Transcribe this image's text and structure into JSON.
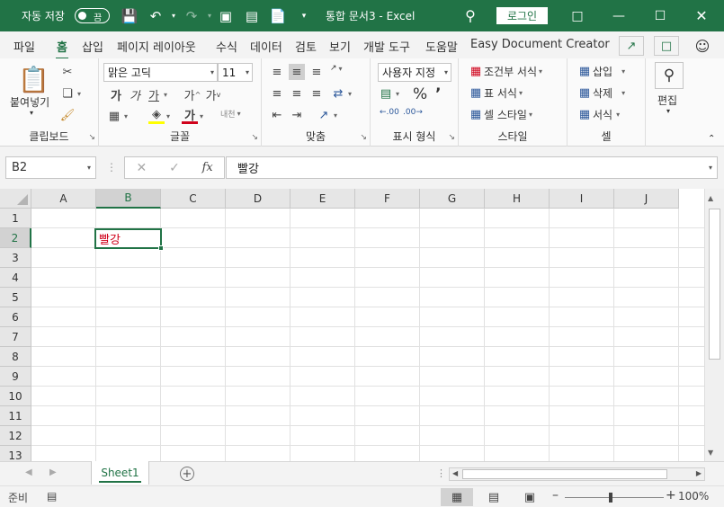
{
  "titlebar": {
    "autosave_label": "자동 저장",
    "autosave_state": "끔",
    "doc_title": "통합 문서3  -  Excel",
    "login_label": "로그인"
  },
  "tabs": [
    "파일",
    "홈",
    "삽입",
    "페이지 레이아웃",
    "수식",
    "데이터",
    "검토",
    "보기",
    "개발 도구",
    "도움말",
    "Easy Document Creator"
  ],
  "active_tab": "홈",
  "ribbon": {
    "clipboard": {
      "paste": "붙여넣기",
      "label": "클립보드"
    },
    "font": {
      "name": "맑은 고딕",
      "size": "11",
      "label": "글꼴"
    },
    "align": {
      "label": "맞춤"
    },
    "number": {
      "format": "사용자 지정",
      "label": "표시 형식"
    },
    "styles": {
      "cond": "조건부 서식",
      "table": "표 서식",
      "cell": "셀 스타일",
      "label": "스타일"
    },
    "cells": {
      "insert": "삽입",
      "delete": "삭제",
      "format": "서식",
      "label": "셀"
    },
    "edit": {
      "label": "편집"
    }
  },
  "formula": {
    "namebox": "B2",
    "content": "빨강"
  },
  "grid": {
    "columns": [
      "A",
      "B",
      "C",
      "D",
      "E",
      "F",
      "G",
      "H",
      "I",
      "J"
    ],
    "rows": [
      "1",
      "2",
      "3",
      "4",
      "5",
      "6",
      "7",
      "8",
      "9",
      "10",
      "11",
      "12",
      "13"
    ],
    "selected_column": "B",
    "selected_row": "2",
    "active_cell_value": "빨강",
    "active_cell_text_color": "#d0021b"
  },
  "sheets": [
    "Sheet1"
  ],
  "status": {
    "ready": "준비",
    "zoom": "100%"
  },
  "colors": {
    "accent": "#217346"
  }
}
